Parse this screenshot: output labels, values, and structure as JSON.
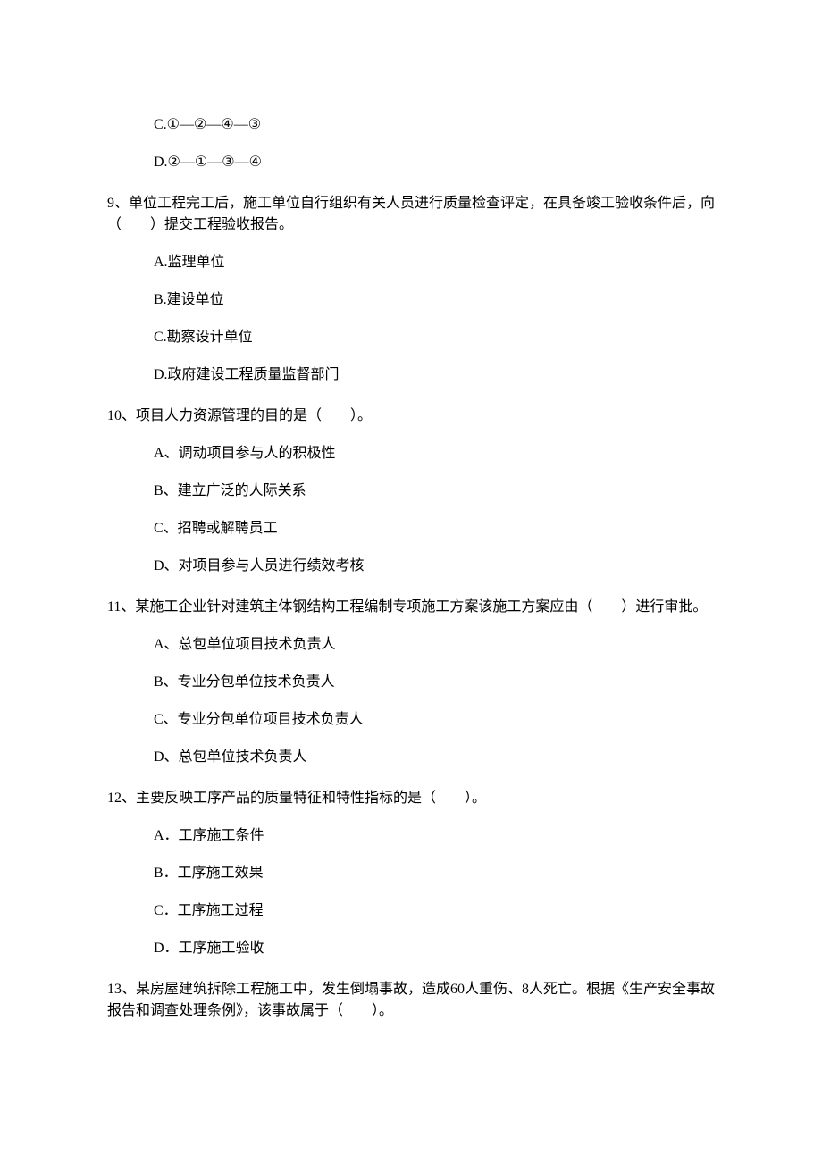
{
  "q8": {
    "options": [
      "",
      "",
      "C.①—②—④—③",
      "D.②—①—③—④"
    ]
  },
  "q9": {
    "stem": "9、单位工程完工后，施工单位自行组织有关人员进行质量检查评定，在具备竣工验收条件后，向（　　）提交工程验收报告。",
    "options": [
      "A.监理单位",
      "B.建设单位",
      "C.勘察设计单位",
      "D.政府建设工程质量监督部门"
    ]
  },
  "q10": {
    "stem": "10、项目人力资源管理的目的是（　　）。",
    "options": [
      "A、调动项目参与人的积极性",
      "B、建立广泛的人际关系",
      "C、招聘或解聘员工",
      "D、对项目参与人员进行绩效考核"
    ]
  },
  "q11": {
    "stem": "11、某施工企业针对建筑主体钢结构工程编制专项施工方案该施工方案应由（　　）进行审批。",
    "options": [
      "A、总包单位项目技术负责人",
      "B、专业分包单位技术负责人",
      "C、专业分包单位项目技术负责人",
      "D、总包单位技术负责人"
    ]
  },
  "q12": {
    "stem": "12、主要反映工序产品的质量特征和特性指标的是（　　）。",
    "options": [
      "A．工序施工条件",
      "B．工序施工效果",
      "C．工序施工过程",
      "D．工序施工验收"
    ]
  },
  "q13": {
    "stem": "13、某房屋建筑拆除工程施工中，发生倒塌事故，造成60人重伤、8人死亡。根据《生产安全事故报告和调查处理条例》，该事故属于（　　）。"
  }
}
